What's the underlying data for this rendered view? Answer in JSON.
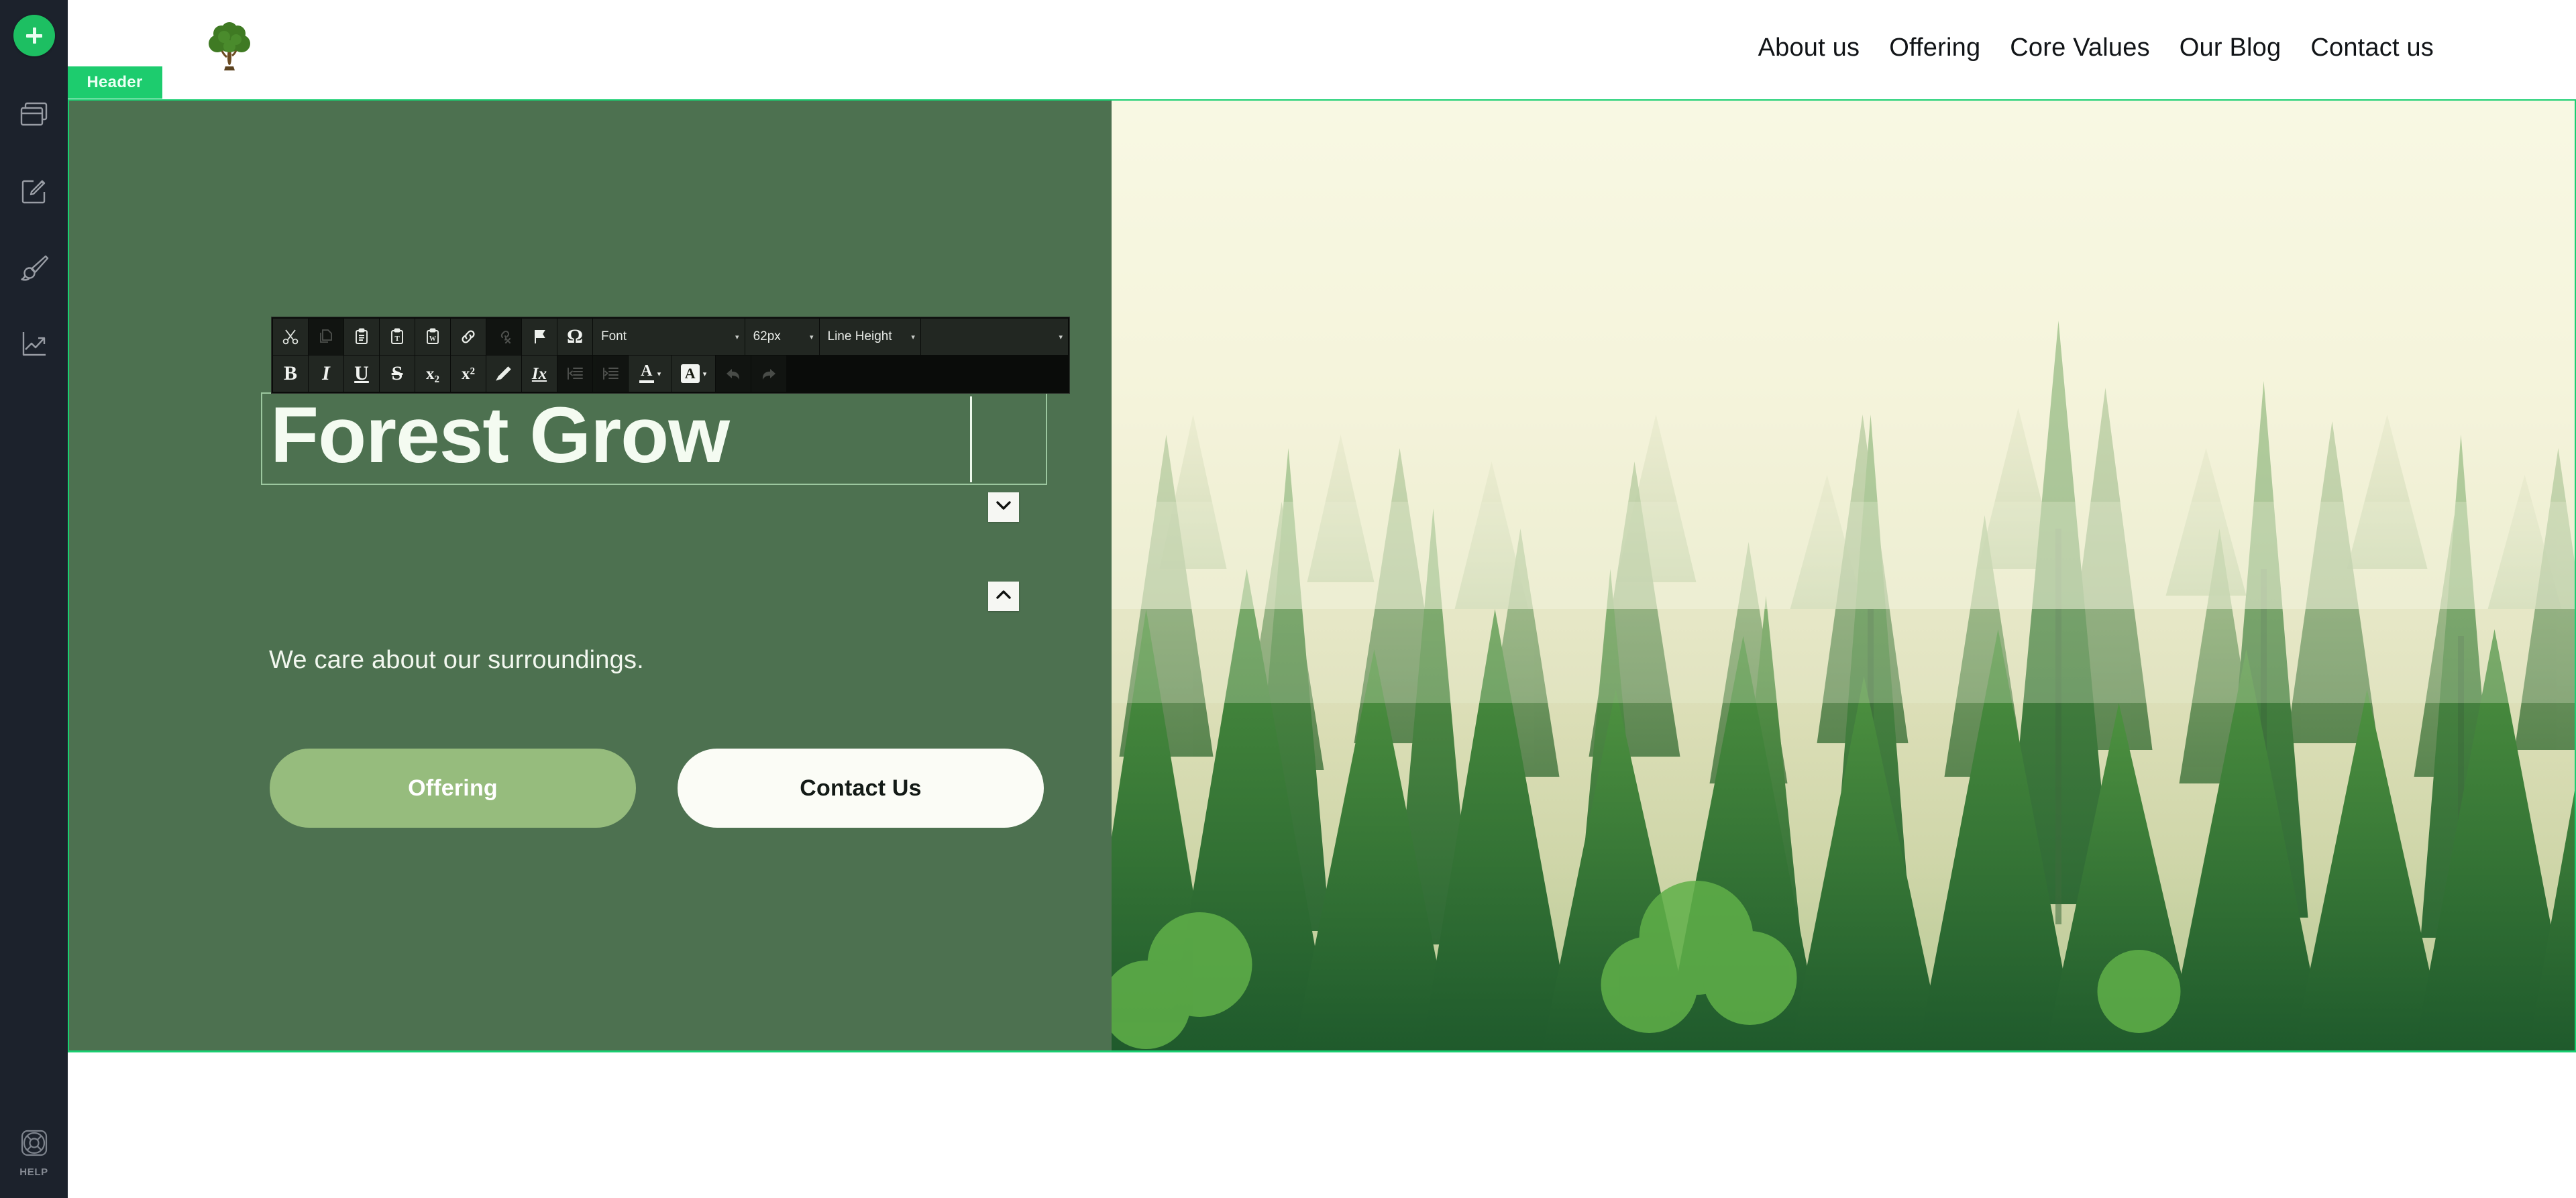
{
  "rail": {
    "add_button": {
      "name": "add-element",
      "icon": "plus-icon"
    },
    "items": [
      {
        "id": "pages",
        "icon": "pages-stack-icon",
        "label": "Pages"
      },
      {
        "id": "editor",
        "icon": "edit-square-icon",
        "label": "Edit"
      },
      {
        "id": "design",
        "icon": "paintbrush-icon",
        "label": "Design"
      },
      {
        "id": "analytics",
        "icon": "trend-up-icon",
        "label": "Analytics"
      }
    ],
    "help": {
      "icon": "lifebuoy-icon",
      "label": "HELP"
    }
  },
  "header": {
    "logo_alt": "tree-logo",
    "nav": [
      {
        "label": "About us"
      },
      {
        "label": "Offering"
      },
      {
        "label": "Core Values"
      },
      {
        "label": "Our Blog"
      },
      {
        "label": "Contact us"
      }
    ]
  },
  "hero": {
    "section_badge": "Header",
    "heading": "Forest Grow",
    "subtitle": "We care about our surroundings.",
    "buttons": [
      {
        "label": "Offering",
        "style": "primary"
      },
      {
        "label": "Contact Us",
        "style": "light"
      }
    ],
    "nudge_down_icon": "chevron-down-icon",
    "nudge_up_icon": "chevron-up-icon",
    "image_alt": "misty-pine-forest"
  },
  "editor_toolbar": {
    "row1": [
      {
        "name": "cut-button",
        "icon": "scissors-icon",
        "enabled": true
      },
      {
        "name": "copy-button",
        "icon": "copy-icon",
        "enabled": false
      },
      {
        "name": "paste-button",
        "icon": "clipboard-icon",
        "enabled": true
      },
      {
        "name": "paste-as-text-button",
        "icon": "clipboard-text-icon",
        "enabled": true
      },
      {
        "name": "paste-from-word-button",
        "icon": "clipboard-word-icon",
        "enabled": true
      },
      {
        "name": "link-button",
        "icon": "link-icon",
        "enabled": true
      },
      {
        "name": "unlink-button",
        "icon": "unlink-icon",
        "enabled": false
      },
      {
        "name": "anchor-button",
        "icon": "flag-icon",
        "enabled": true
      },
      {
        "name": "special-char-button",
        "icon": "omega-icon",
        "enabled": true
      }
    ],
    "font_select": {
      "label": "Font",
      "caret": "▾"
    },
    "font_size_select": {
      "label": "62px",
      "caret": "▾"
    },
    "line_height_select": {
      "label": "Line Height",
      "caret": "▾"
    },
    "extra_select": {
      "label": "",
      "caret": "▾"
    },
    "row2": [
      {
        "name": "bold-button",
        "icon": "bold-icon",
        "glyph": "B",
        "enabled": true
      },
      {
        "name": "italic-button",
        "icon": "italic-icon",
        "glyph": "I",
        "enabled": true
      },
      {
        "name": "underline-button",
        "icon": "underline-icon",
        "glyph": "U",
        "enabled": true
      },
      {
        "name": "strikethrough-button",
        "icon": "strikethrough-icon",
        "glyph": "S",
        "enabled": true
      },
      {
        "name": "subscript-button",
        "icon": "subscript-icon",
        "glyph": "x₂",
        "enabled": true
      },
      {
        "name": "superscript-button",
        "icon": "superscript-icon",
        "glyph": "x²",
        "enabled": true
      },
      {
        "name": "copy-formatting-button",
        "icon": "format-painter-icon",
        "glyph": "",
        "enabled": true
      },
      {
        "name": "remove-format-button",
        "icon": "remove-format-icon",
        "glyph": "Ix",
        "enabled": true
      },
      {
        "name": "outdent-button",
        "icon": "outdent-icon",
        "glyph": "",
        "enabled": false
      },
      {
        "name": "indent-button",
        "icon": "indent-icon",
        "glyph": "",
        "enabled": false
      },
      {
        "name": "text-color-button",
        "icon": "text-color-icon",
        "glyph": "A",
        "enabled": true
      },
      {
        "name": "bg-color-button",
        "icon": "background-color-icon",
        "glyph": "A",
        "enabled": true
      },
      {
        "name": "undo-button",
        "icon": "undo-arrow-icon",
        "glyph": "",
        "enabled": false
      },
      {
        "name": "redo-button",
        "icon": "redo-arrow-icon",
        "glyph": "",
        "enabled": false
      }
    ]
  },
  "colors": {
    "rail_bg": "#1c222c",
    "accent_green": "#1dbf62",
    "badge_green": "#1dcc6e",
    "hero_panel": "#4d7150",
    "btn_primary": "#96bc7d",
    "btn_light": "#fbfcf6"
  }
}
